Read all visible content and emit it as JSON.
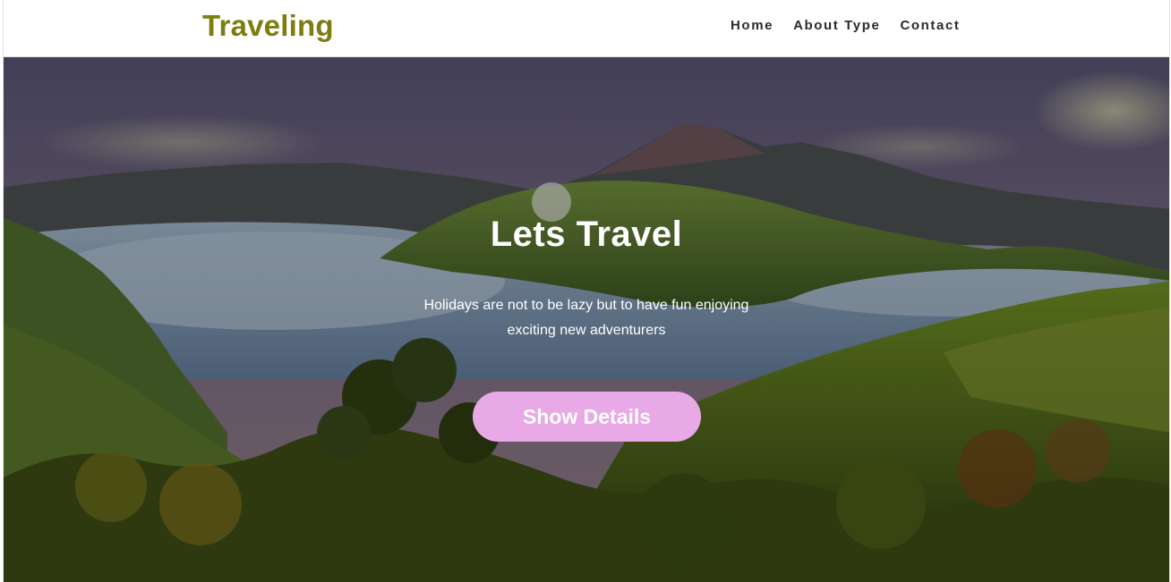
{
  "header": {
    "brand": "Traveling",
    "nav": [
      {
        "label": "Home"
      },
      {
        "label": "About Type"
      },
      {
        "label": "Contact"
      }
    ]
  },
  "hero": {
    "title": "Lets Travel",
    "text": "Holidays are not to be lazy but to have fun enjoying exciting new adventurers",
    "cta_label": "Show Details",
    "background_image": "mountain-volcano-landscape"
  },
  "colors": {
    "brand": "#7d7d12",
    "cta": "#e9a8e6",
    "nav_text": "#2b2b2b",
    "hero_text": "#ffffff"
  }
}
